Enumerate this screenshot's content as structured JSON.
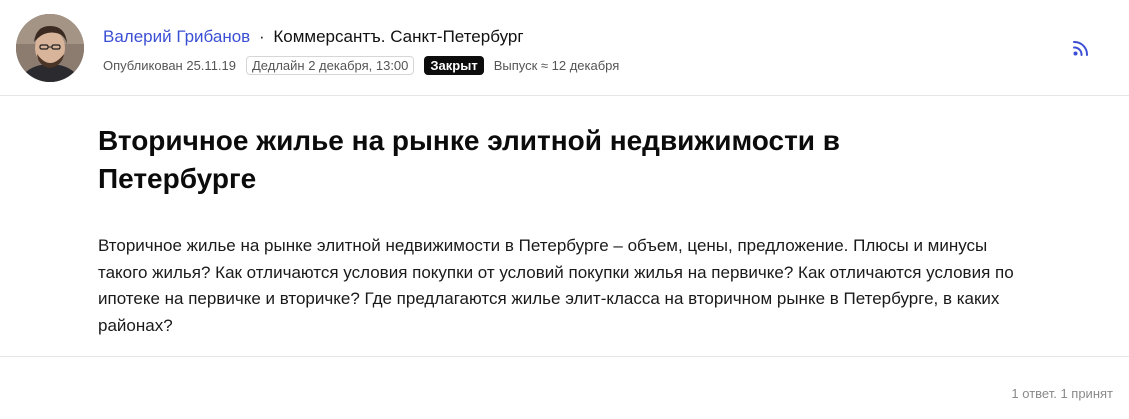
{
  "author": {
    "name": "Валерий Грибанов",
    "separator": "·",
    "source": "Коммерсантъ. Санкт-Петербург"
  },
  "meta": {
    "published": "Опубликован 25.11.19",
    "deadline": "Дедлайн 2 декабря, 13:00",
    "status_badge": "Закрыт",
    "release": "Выпуск ≈ 12 декабря"
  },
  "icons": {
    "subscribe": "rss-icon"
  },
  "colors": {
    "author_link": "#3b4fd4",
    "badge_bg": "#0c0c0c",
    "rss": "#3b4fd4"
  },
  "question": {
    "title": "Вторичное жилье на рынке элитной недвижимости в Петербурге",
    "description": "Вторичное жилье на рынке элитной недвижимости в Петербурге – объем, цены, предложение. Плюсы и минусы такого жилья? Как отличаются условия покупки от условий покупки жилья на первичке? Как отличаются условия по ипотеке на первичке и вторичке? Где предлагаются жилье элит-класса на вторичном рынке в Петербурге, в каких районах?"
  },
  "footer": {
    "answers_count": "1 ответ. 1 принят"
  }
}
